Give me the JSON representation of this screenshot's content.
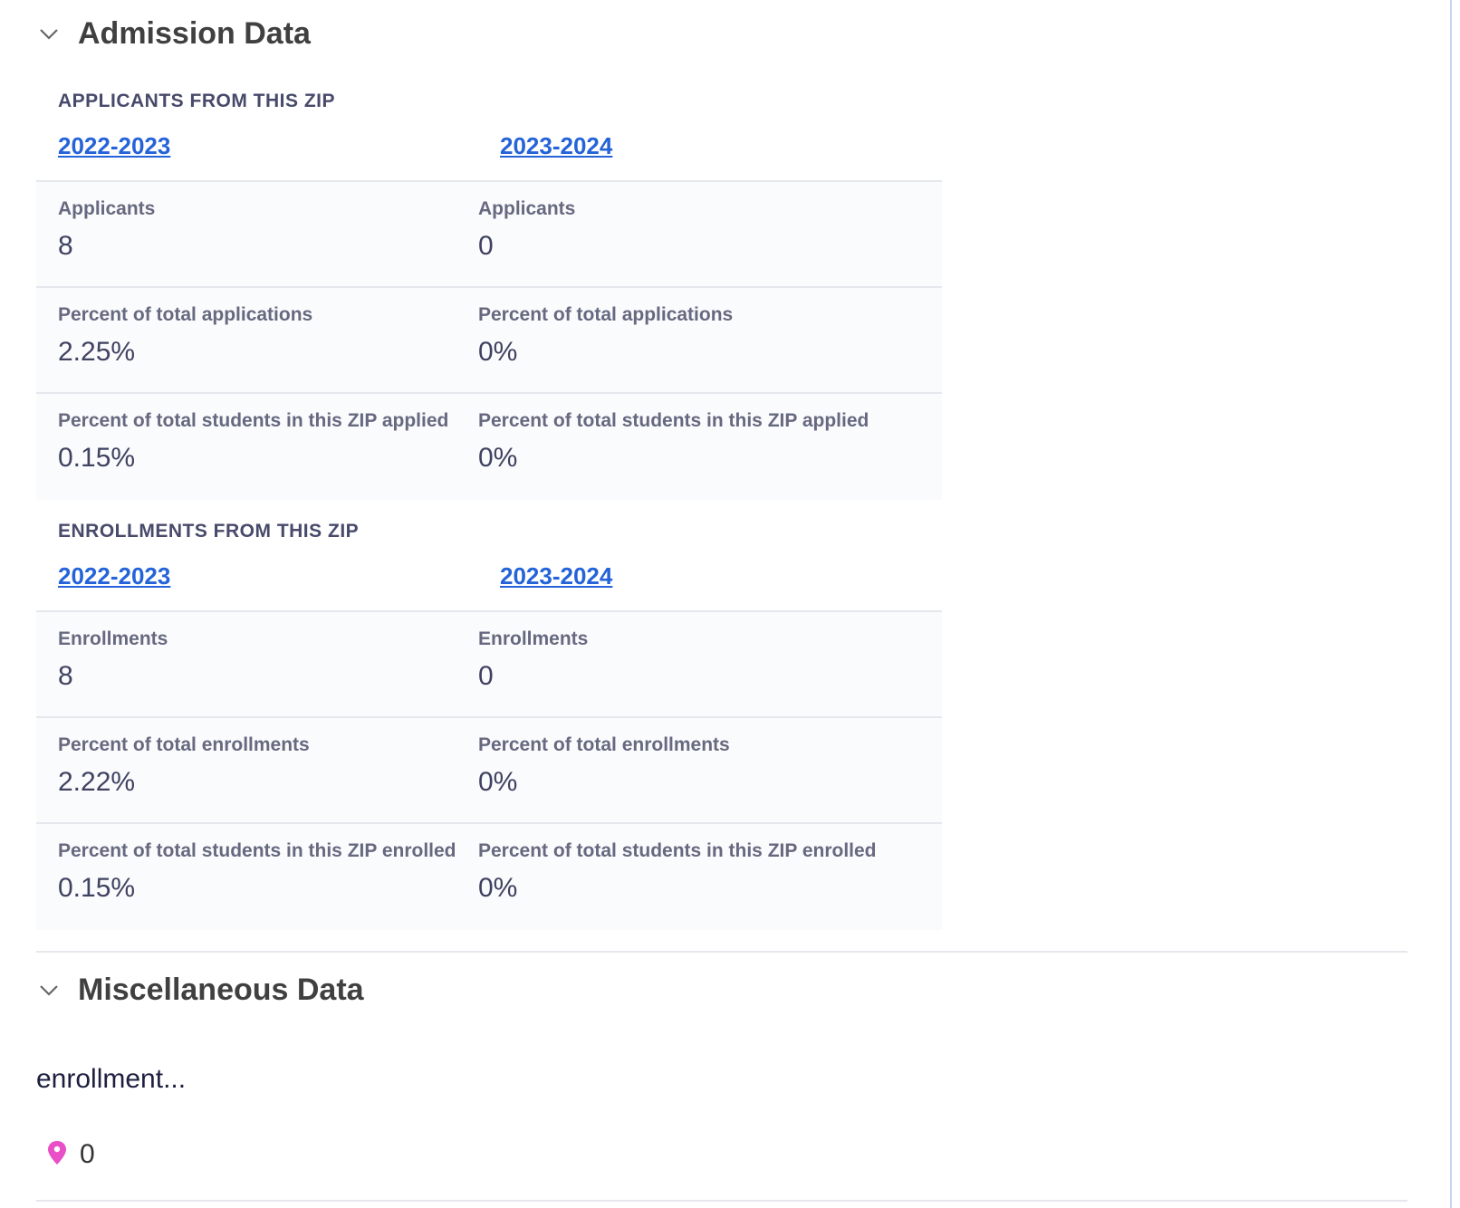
{
  "admission": {
    "title": "Admission Data",
    "applicants": {
      "heading": "APPLICANTS FROM THIS ZIP",
      "years": [
        "2022-2023",
        "2023-2024"
      ],
      "rows": [
        {
          "label": "Applicants",
          "values": [
            "8",
            "0"
          ]
        },
        {
          "label": "Percent of total applications",
          "values": [
            "2.25%",
            "0%"
          ]
        },
        {
          "label": "Percent of total students in this ZIP applied",
          "values": [
            "0.15%",
            "0%"
          ]
        }
      ]
    },
    "enrollments": {
      "heading": "ENROLLMENTS FROM THIS ZIP",
      "years": [
        "2022-2023",
        "2023-2024"
      ],
      "rows": [
        {
          "label": "Enrollments",
          "values": [
            "8",
            "0"
          ]
        },
        {
          "label": "Percent of total enrollments",
          "values": [
            "2.22%",
            "0%"
          ]
        },
        {
          "label": "Percent of total students in this ZIP enrolled",
          "values": [
            "0.15%",
            "0%"
          ]
        }
      ]
    }
  },
  "misc": {
    "title": "Miscellaneous Data",
    "text": "enrollment...",
    "pin_count": "0",
    "pin_color": "#e94fc7"
  },
  "colors": {
    "link": "#2563d9"
  }
}
